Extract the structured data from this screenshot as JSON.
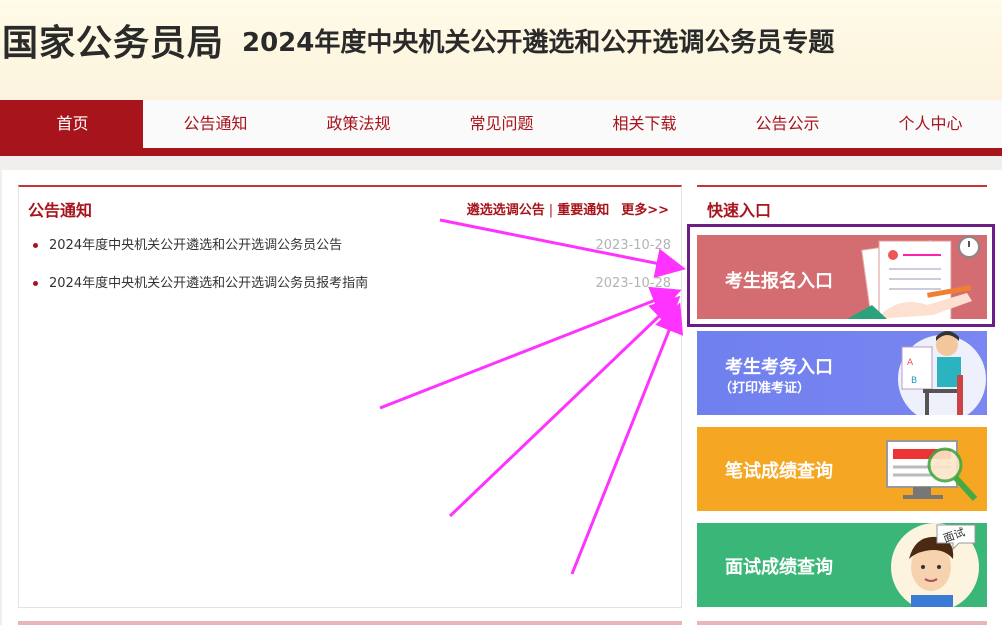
{
  "header": {
    "site_name": "国家公务员局",
    "topic_title": "2024年度中央机关公开遴选和公开选调公务员专题"
  },
  "nav": {
    "items": [
      {
        "label": "首页",
        "active": true
      },
      {
        "label": "公告通知"
      },
      {
        "label": "政策法规"
      },
      {
        "label": "常见问题"
      },
      {
        "label": "相关下载"
      },
      {
        "label": "公告公示"
      },
      {
        "label": "个人中心"
      }
    ]
  },
  "notice": {
    "title": "公告通知",
    "links": [
      "遴选选调公告",
      "重要通知"
    ],
    "separator": "|",
    "more": "更多>>",
    "items": [
      {
        "text": "2024年度中央机关公开遴选和公开选调公务员公告",
        "date": "2023-10-28"
      },
      {
        "text": "2024年度中央机关公开遴选和公开选调公务员报考指南",
        "date": "2023-10-28"
      }
    ]
  },
  "quick": {
    "title": "快速入口",
    "entries": [
      {
        "label": "考生报名入口",
        "color": "#d36d72",
        "icon": "application-form-icon"
      },
      {
        "label": "考生考务入口",
        "sublabel": "（打印准考证）",
        "color": "#7080ee",
        "icon": "person-at-computer-icon"
      },
      {
        "label": "笔试成绩查询",
        "color": "#f5a623",
        "icon": "magnifier-monitor-icon"
      },
      {
        "label": "面试成绩查询",
        "color": "#3ab778",
        "icon": "interviewee-face-icon",
        "bubble": "面试"
      }
    ]
  },
  "colors": {
    "brand_red": "#a8141c",
    "highlight_border": "#6b1f85",
    "annotation_arrow": "#ff33ff"
  }
}
